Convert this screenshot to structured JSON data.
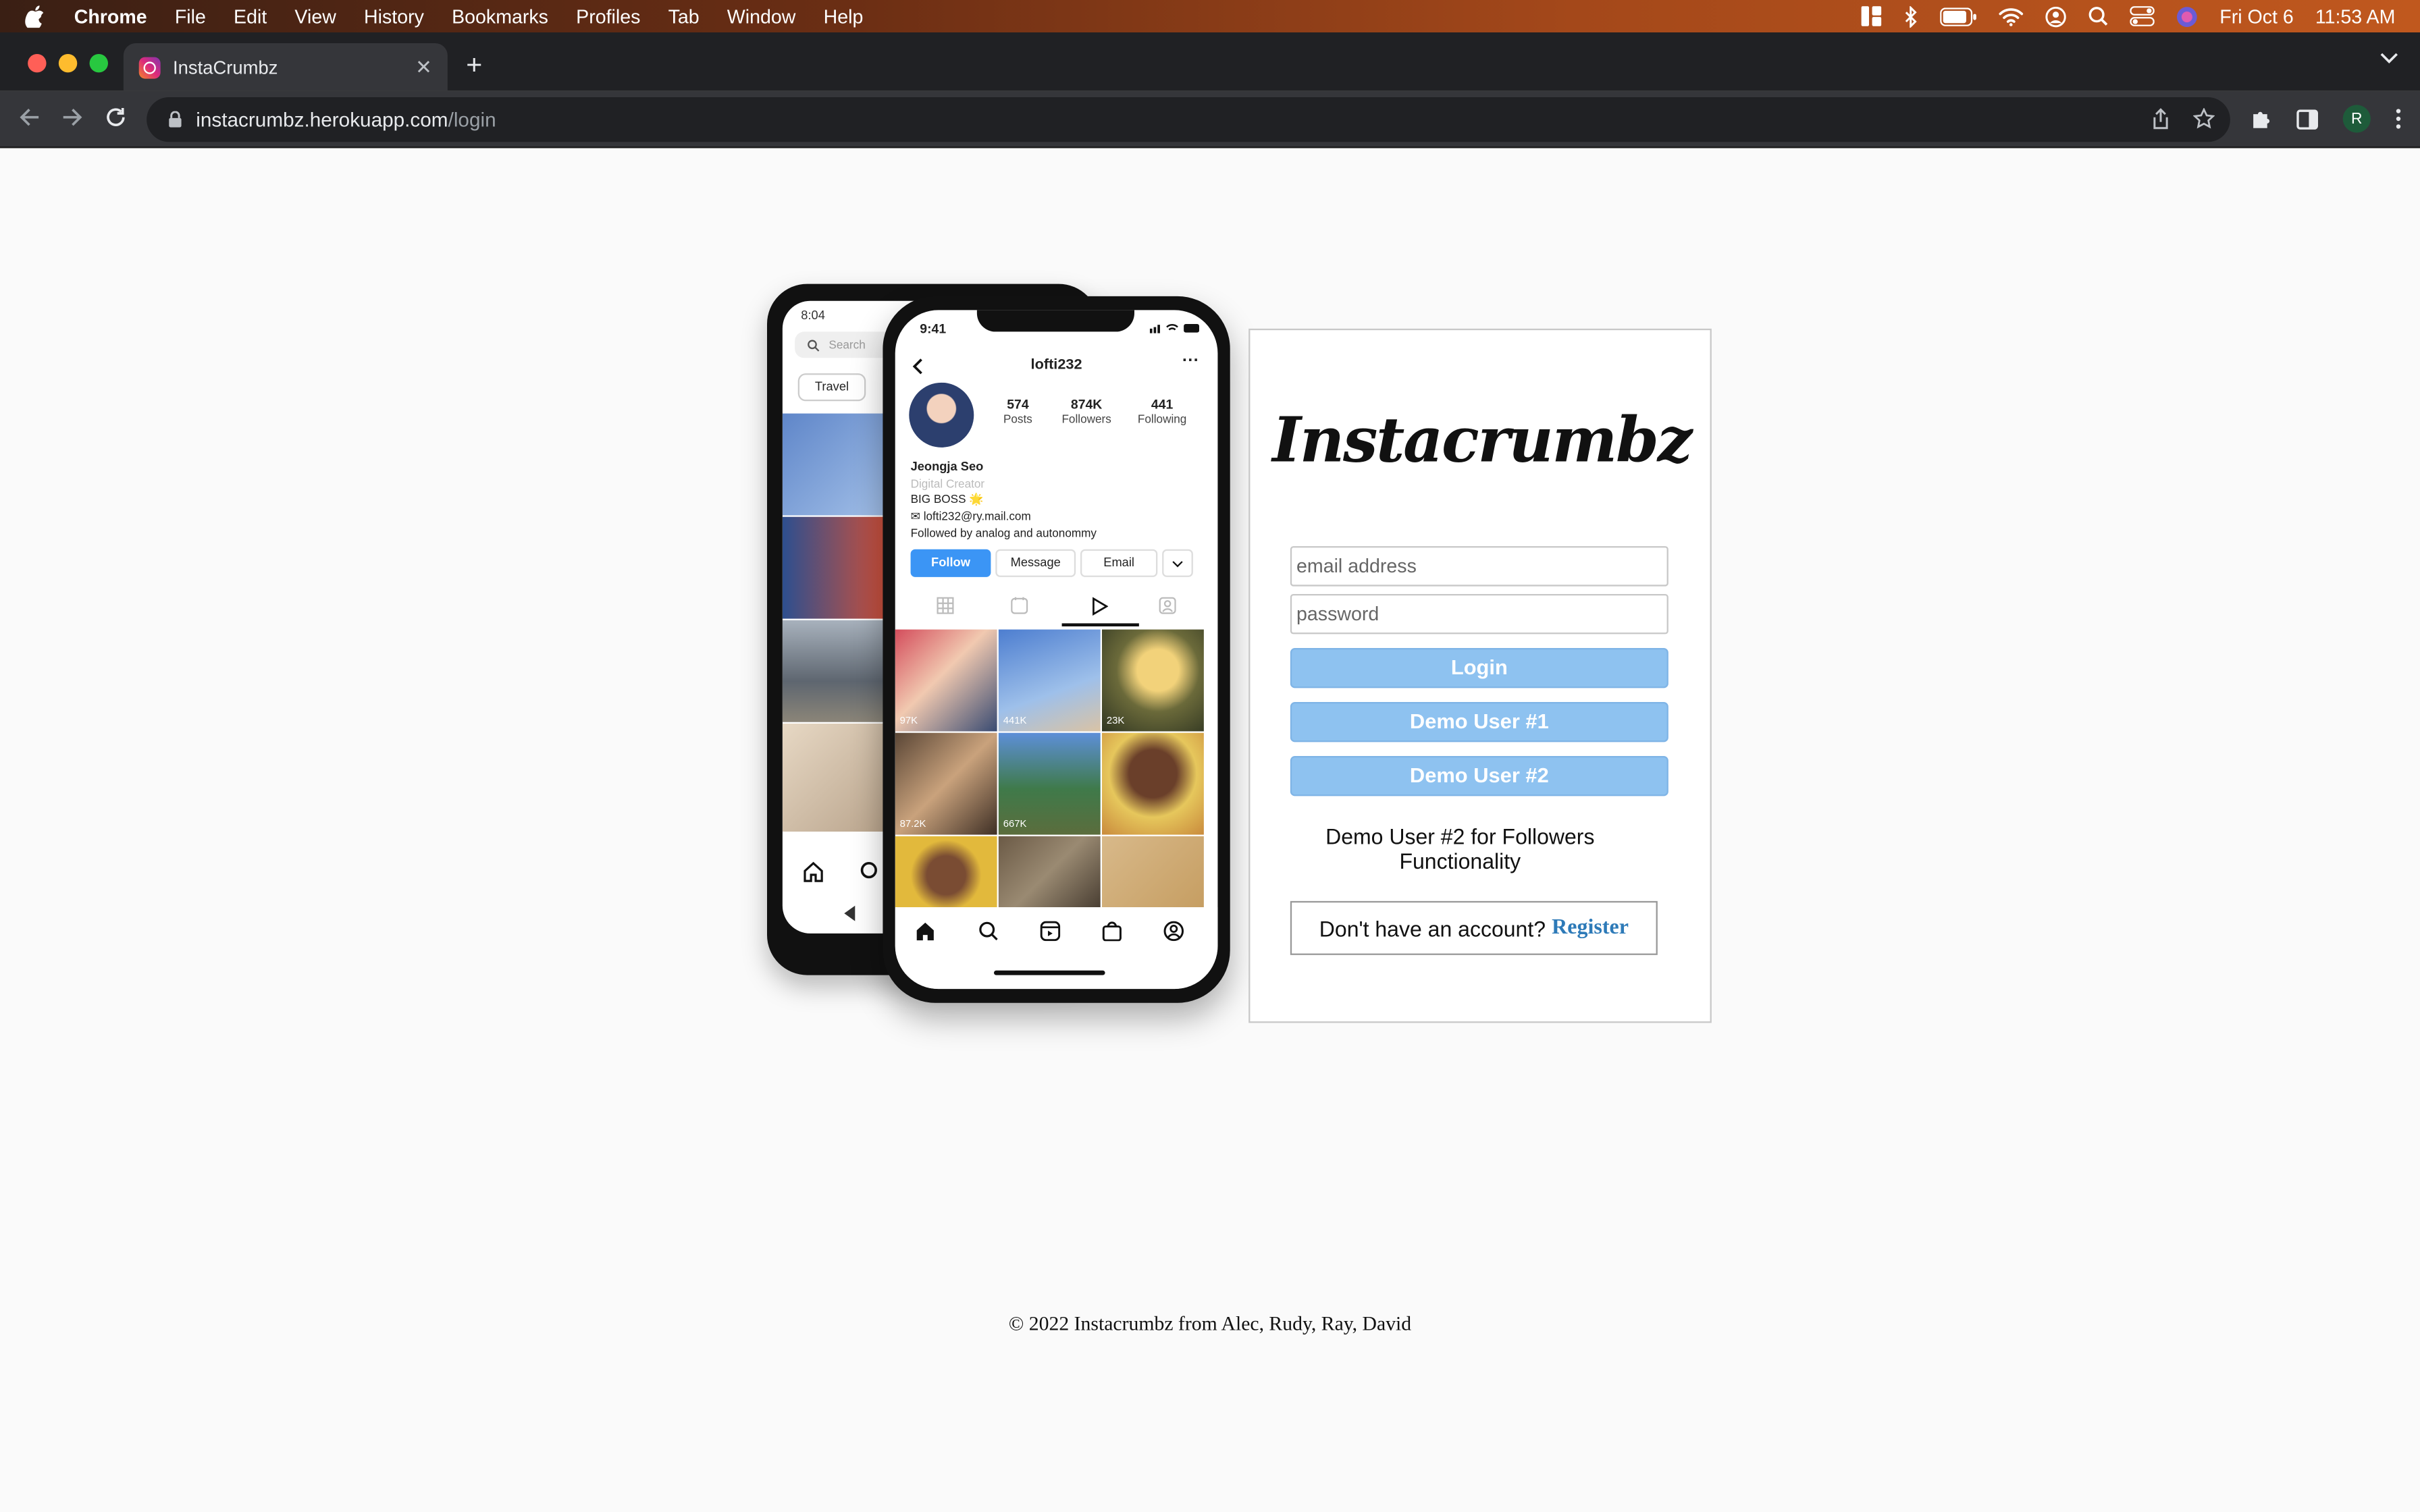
{
  "menubar": {
    "app": "Chrome",
    "items": [
      "File",
      "Edit",
      "View",
      "History",
      "Bookmarks",
      "Profiles",
      "Tab",
      "Window",
      "Help"
    ],
    "date": "Fri Oct 6",
    "time": "11:53 AM"
  },
  "browser": {
    "tab_title": "InstaCrumbz",
    "url_host": "instacrumbz.herokuapp.com",
    "url_path": "/login",
    "profile_initial": "R"
  },
  "phone_back": {
    "time": "8:04",
    "search_placeholder": "Search",
    "chip": "Travel"
  },
  "phone_front": {
    "time": "9:41",
    "username": "lofti232",
    "posts_count": "574",
    "posts_label": "Posts",
    "followers_count": "874K",
    "followers_label": "Followers",
    "following_count": "441",
    "following_label": "Following",
    "name": "Jeongja Seo",
    "category": "Digital Creator",
    "bio": "BIG BOSS 🌟",
    "email": "✉ lofti232@ry.mail.com",
    "followed_by": "Followed by analog and autonommy",
    "follow_btn": "Follow",
    "message_btn": "Message",
    "email_btn": "Email",
    "tile_counts": [
      "97K",
      "441K",
      "23K",
      "87.2K",
      "667K"
    ]
  },
  "login": {
    "logo": "Instacrumbz",
    "email_placeholder": "email address",
    "password_placeholder": "password",
    "login_btn": "Login",
    "demo1_btn": "Demo User #1",
    "demo2_btn": "Demo User #2",
    "note": "Demo User #2 for Followers Functionality",
    "register_prompt": "Don't have an account?",
    "register_link": "Register"
  },
  "footer": "© 2022 Instacrumbz from Alec, Rudy, Ray, David",
  "colors": {
    "button_blue": "#8ec2f0",
    "link_blue": "#2d7ab8",
    "follow_blue": "#3b95f5"
  }
}
